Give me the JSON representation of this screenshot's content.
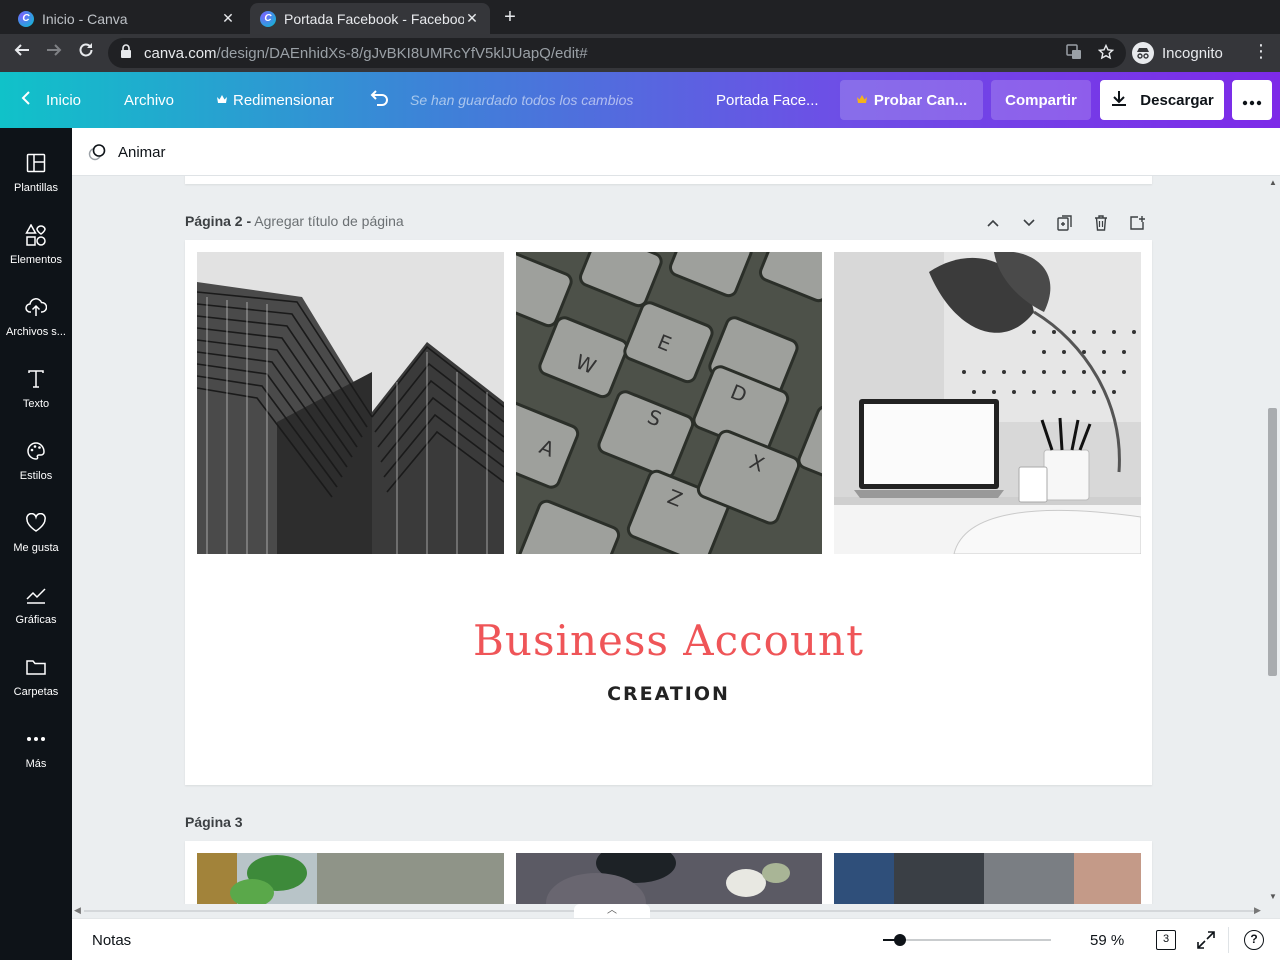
{
  "browser": {
    "tabs": [
      {
        "title": "Inicio - Canva",
        "active": false
      },
      {
        "title": "Portada Facebook - Facebook",
        "active": true
      }
    ],
    "url_domain": "canva.com",
    "url_path": "/design/DAEnhidXs-8/gJvBKI8UMRcYfV5klJUapQ/edit#",
    "profile_label": "Incognito"
  },
  "header": {
    "home_label": "Inicio",
    "file_label": "Archivo",
    "resize_label": "Redimensionar",
    "saved_status": "Se han guardado todos los cambios",
    "doc_title": "Portada Face...",
    "try_label": "Probar Can...",
    "share_label": "Compartir",
    "download_label": "Descargar",
    "accent_color": "#7d2ae8"
  },
  "sidebar": {
    "items": [
      {
        "label": "Plantillas",
        "icon": "templates-icon"
      },
      {
        "label": "Elementos",
        "icon": "elements-icon"
      },
      {
        "label": "Archivos s...",
        "icon": "upload-icon"
      },
      {
        "label": "Texto",
        "icon": "text-icon"
      },
      {
        "label": "Estilos",
        "icon": "palette-icon"
      },
      {
        "label": "Me gusta",
        "icon": "heart-icon"
      },
      {
        "label": "Gráficas",
        "icon": "chart-icon"
      },
      {
        "label": "Carpetas",
        "icon": "folder-icon"
      },
      {
        "label": "Más",
        "icon": "more-icon"
      }
    ]
  },
  "animate": {
    "label": "Animar"
  },
  "pages": {
    "page2": {
      "label": "Página 2 -",
      "title_placeholder": "Agregar título de página",
      "headline": "Business Account",
      "subheadline": "CREATION",
      "headline_color": "#ef5558",
      "images": [
        "skyscraper-photo",
        "keyboard-photo",
        "desk-laptop-photo"
      ]
    },
    "page3": {
      "label": "Página 3",
      "images": [
        "plant-photo",
        "flowers-photo",
        "person-photo"
      ]
    }
  },
  "footer": {
    "notes_label": "Notas",
    "zoom_percent": 59,
    "zoom_label": "59 %",
    "page_count": "3",
    "help_label": "?"
  }
}
